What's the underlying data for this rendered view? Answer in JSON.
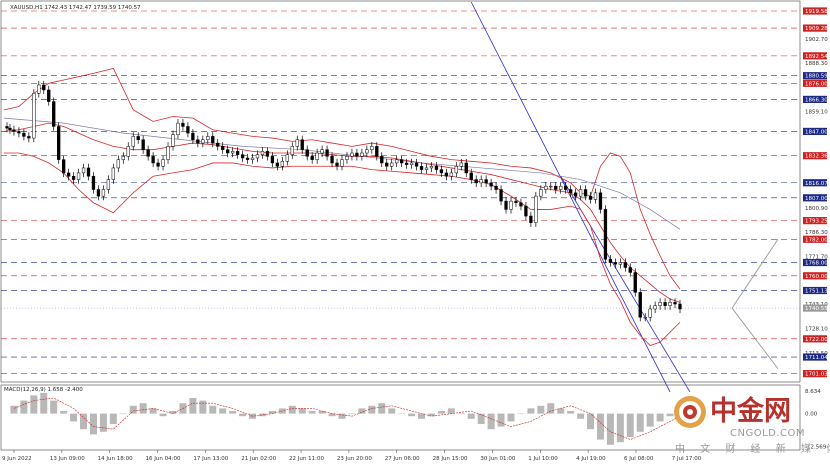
{
  "chart_data": {
    "type": "candlestick",
    "symbol_header": "XAUUSD,H1  1742.43 1742.47 1739.59 1740.57",
    "indicator_header": "MACD(12,26,9) 1.658 -2.400",
    "price_axis_labels": [
      "1919.58",
      "1909.28",
      "1902.70",
      "1892.54",
      "1888.30",
      "1880.59",
      "1876.00",
      "1866.30",
      "1859.10",
      "1847.00",
      "1832.36",
      "1816.07",
      "1807.00",
      "1800.90",
      "1793.25",
      "1786.30",
      "1782.00",
      "1771.70",
      "1768.00",
      "1760.00",
      "1751.13",
      "1743.10",
      "1740.55",
      "1728.10",
      "1722.00",
      "1713.50",
      "1711.04",
      "1701.03"
    ],
    "macd_axis_labels": [
      "8.634",
      "0.00",
      "-12.569"
    ],
    "x_tick_labels": [
      "9 Jun 2022",
      "13 Jun 09:00",
      "14 Jun 18:00",
      "16 Jun 04:00",
      "17 Jun 13:00",
      "21 Jun 02:00",
      "22 Jun 11:00",
      "23 Jun 20:00",
      "27 Jun 06:00",
      "28 Jun 15:00",
      "30 Jun 01:00",
      "1 Jul 10:00",
      "4 Jul 19:00",
      "6 Jul 08:00",
      "7 Jul 17:00"
    ],
    "resistance_levels": [
      1919.58,
      1909.28,
      1892.54,
      1876.0,
      1832.36,
      1793.25,
      1782.0,
      1760.0,
      1722.0,
      1701.03
    ],
    "support_levels": [
      1880.59,
      1866.3,
      1847.0,
      1816.07,
      1807.0,
      1768.0,
      1751.13,
      1711.04
    ],
    "current_price": 1740.55,
    "ylim": [
      1696,
      1925
    ],
    "macd_ylim": [
      -14,
      11
    ],
    "series": [
      {
        "name": "price",
        "x": [
          0,
          3,
          6,
          10,
          15,
          20,
          25,
          30,
          35,
          40,
          45,
          50,
          55,
          60,
          65,
          70,
          75,
          80,
          85,
          90,
          95,
          100,
          105,
          110,
          115,
          120,
          125,
          130,
          135,
          140,
          145,
          150,
          155,
          160,
          165,
          170,
          175,
          180,
          185,
          190,
          195,
          200,
          205,
          210,
          215,
          220,
          225,
          230,
          235,
          240,
          245,
          250,
          255,
          260,
          265,
          270,
          275,
          280,
          285,
          290,
          295,
          300,
          305,
          310,
          315,
          320,
          325,
          330,
          335,
          340,
          345,
          350,
          355,
          360,
          365,
          370,
          375,
          380,
          385,
          390,
          395,
          400,
          405,
          410,
          415,
          420,
          425,
          430,
          435,
          440,
          445,
          450,
          455,
          460,
          465,
          470,
          475,
          480,
          485,
          490,
          495,
          500,
          505,
          510,
          515,
          520,
          525,
          530,
          535,
          540,
          545,
          550,
          555,
          560,
          565,
          570,
          575,
          580,
          585,
          590,
          595,
          600,
          605,
          610,
          615,
          620,
          625,
          630,
          635,
          640,
          645,
          650,
          655,
          660,
          665,
          670,
          675,
          680
        ],
        "y": [
          1850,
          1849,
          1848,
          1847,
          1846,
          1844,
          1843,
          1870,
          1875,
          1872,
          1865,
          1850,
          1830,
          1822,
          1820,
          1818,
          1822,
          1825,
          1820,
          1812,
          1808,
          1812,
          1818,
          1825,
          1830,
          1832,
          1838,
          1844,
          1842,
          1836,
          1832,
          1828,
          1826,
          1830,
          1838,
          1845,
          1852,
          1850,
          1846,
          1842,
          1840,
          1842,
          1844,
          1840,
          1838,
          1836,
          1834,
          1835,
          1833,
          1831,
          1830,
          1831,
          1833,
          1835,
          1832,
          1828,
          1826,
          1829,
          1833,
          1838,
          1842,
          1836,
          1832,
          1830,
          1834,
          1836,
          1832,
          1828,
          1826,
          1830,
          1832,
          1834,
          1832,
          1834,
          1836,
          1838,
          1832,
          1828,
          1826,
          1828,
          1830,
          1828,
          1827,
          1828,
          1826,
          1824,
          1825,
          1826,
          1824,
          1822,
          1820,
          1822,
          1826,
          1828,
          1822,
          1818,
          1816,
          1818,
          1816,
          1814,
          1812,
          1805,
          1800,
          1805,
          1804,
          1802,
          1796,
          1792,
          1808,
          1812,
          1814,
          1814,
          1812,
          1814,
          1812,
          1810,
          1808,
          1812,
          1808,
          1806,
          1810,
          1800,
          1770,
          1768,
          1767,
          1768,
          1765,
          1762,
          1750,
          1735,
          1735,
          1740,
          1742,
          1744,
          1742,
          1744,
          1743,
          1740
        ]
      },
      {
        "name": "bollinger_upper",
        "x": [
          0,
          15,
          30,
          45,
          60,
          75,
          90,
          110,
          130,
          150,
          170,
          190,
          210,
          230,
          250,
          270,
          290,
          310,
          330,
          350,
          370,
          390,
          410,
          430,
          450,
          470,
          490,
          510,
          530,
          550,
          570,
          580,
          590,
          600,
          610,
          620,
          630,
          640,
          650,
          660,
          670,
          680
        ],
        "y": [
          1860,
          1862,
          1870,
          1876,
          1878,
          1880,
          1882,
          1885,
          1860,
          1853,
          1856,
          1855,
          1848,
          1846,
          1844,
          1843,
          1841,
          1842,
          1840,
          1838,
          1840,
          1838,
          1835,
          1832,
          1830,
          1829,
          1828,
          1826,
          1825,
          1822,
          1816,
          1810,
          1808,
          1826,
          1834,
          1832,
          1822,
          1800,
          1785,
          1772,
          1760,
          1752
        ]
      },
      {
        "name": "bollinger_middle",
        "x": [
          0,
          15,
          30,
          45,
          60,
          75,
          90,
          110,
          130,
          150,
          170,
          190,
          210,
          230,
          250,
          270,
          290,
          310,
          330,
          350,
          370,
          390,
          410,
          430,
          450,
          470,
          490,
          510,
          530,
          550,
          570,
          580,
          590,
          600,
          610,
          620,
          630,
          640,
          650,
          660,
          670,
          680
        ],
        "y": [
          1847,
          1848,
          1850,
          1852,
          1850,
          1846,
          1842,
          1838,
          1836,
          1836,
          1838,
          1840,
          1839,
          1837,
          1835,
          1834,
          1834,
          1834,
          1833,
          1832,
          1832,
          1831,
          1829,
          1827,
          1825,
          1823,
          1821,
          1818,
          1815,
          1812,
          1810,
          1806,
          1800,
          1790,
          1780,
          1772,
          1765,
          1760,
          1755,
          1750,
          1746,
          1744
        ]
      },
      {
        "name": "bollinger_lower",
        "x": [
          0,
          15,
          30,
          45,
          60,
          75,
          90,
          110,
          130,
          150,
          170,
          190,
          210,
          230,
          250,
          270,
          290,
          310,
          330,
          350,
          370,
          390,
          410,
          430,
          450,
          470,
          490,
          510,
          530,
          550,
          570,
          580,
          590,
          600,
          610,
          620,
          630,
          640,
          650,
          660,
          670,
          680
        ],
        "y": [
          1834,
          1834,
          1832,
          1828,
          1822,
          1812,
          1804,
          1798,
          1810,
          1820,
          1822,
          1824,
          1828,
          1828,
          1826,
          1825,
          1826,
          1826,
          1826,
          1826,
          1824,
          1823,
          1822,
          1821,
          1820,
          1818,
          1815,
          1808,
          1800,
          1800,
          1802,
          1800,
          1790,
          1770,
          1755,
          1745,
          1732,
          1724,
          1718,
          1720,
          1726,
          1732
        ]
      },
      {
        "name": "moving_average",
        "x": [
          0,
          60,
          120,
          180,
          240,
          300,
          360,
          420,
          480,
          540,
          580,
          620,
          650,
          680
        ],
        "y": [
          1855,
          1852,
          1846,
          1842,
          1838,
          1836,
          1832,
          1828,
          1825,
          1822,
          1818,
          1810,
          1800,
          1788
        ]
      },
      {
        "name": "macd_histogram",
        "x": [
          10,
          20,
          30,
          40,
          50,
          60,
          70,
          80,
          90,
          100,
          110,
          120,
          130,
          140,
          150,
          160,
          170,
          180,
          190,
          200,
          210,
          220,
          230,
          240,
          250,
          260,
          270,
          280,
          290,
          300,
          310,
          320,
          330,
          340,
          350,
          360,
          370,
          380,
          390,
          400,
          410,
          420,
          430,
          440,
          450,
          460,
          470,
          480,
          490,
          500,
          510,
          520,
          530,
          540,
          550,
          560,
          570,
          580,
          590,
          600,
          610,
          620,
          630,
          640,
          650,
          660,
          670,
          680
        ],
        "y": [
          3,
          5,
          7,
          8,
          5,
          1,
          -3,
          -6,
          -8,
          -7,
          -4,
          0,
          3,
          4,
          2,
          -1,
          1,
          4,
          6,
          5,
          3,
          2,
          1,
          -1,
          -2,
          -1,
          1,
          2,
          3,
          2,
          1,
          1,
          -1,
          -2,
          0,
          2,
          3,
          4,
          2,
          0,
          -1,
          -2,
          -1,
          1,
          2,
          0,
          -2,
          -4,
          -6,
          -5,
          -3,
          0,
          2,
          3,
          4,
          2,
          1,
          -2,
          -6,
          -10,
          -12,
          -11,
          -9,
          -7,
          -5,
          -3,
          -1,
          1
        ]
      },
      {
        "name": "macd_signal",
        "x": [
          10,
          30,
          50,
          70,
          90,
          110,
          130,
          150,
          170,
          190,
          210,
          230,
          250,
          270,
          290,
          310,
          330,
          350,
          370,
          390,
          410,
          430,
          450,
          470,
          490,
          510,
          530,
          550,
          570,
          590,
          610,
          630,
          650,
          670,
          680
        ],
        "y": [
          2,
          5,
          6,
          2,
          -5,
          -6,
          1,
          2,
          0,
          4,
          4,
          2,
          -1,
          0,
          2,
          2,
          0,
          -1,
          2,
          3,
          1,
          -1,
          0,
          1,
          -2,
          -5,
          -3,
          1,
          3,
          0,
          -7,
          -10,
          -7,
          -3,
          -1
        ]
      }
    ]
  },
  "watermark": {
    "chinese": "中金网",
    "english": "CNGOLD.COM",
    "subtitle": "中 文 财 经 新 媒 体"
  },
  "colors": {
    "candle": "#000000",
    "bollinger": "#d62728",
    "moving_average": "#7a7aaa",
    "channel": "#2a2ad0",
    "support_line": "#1c2a86",
    "resistance_line": "#cc2222",
    "support_tag": "#1c2a86",
    "resistance_tag": "#cc2222",
    "current_tag": "#9a9a9a",
    "macd_hist": "#b8b8b8",
    "macd_signal": "#cc2222",
    "brand": "#b5322c"
  }
}
